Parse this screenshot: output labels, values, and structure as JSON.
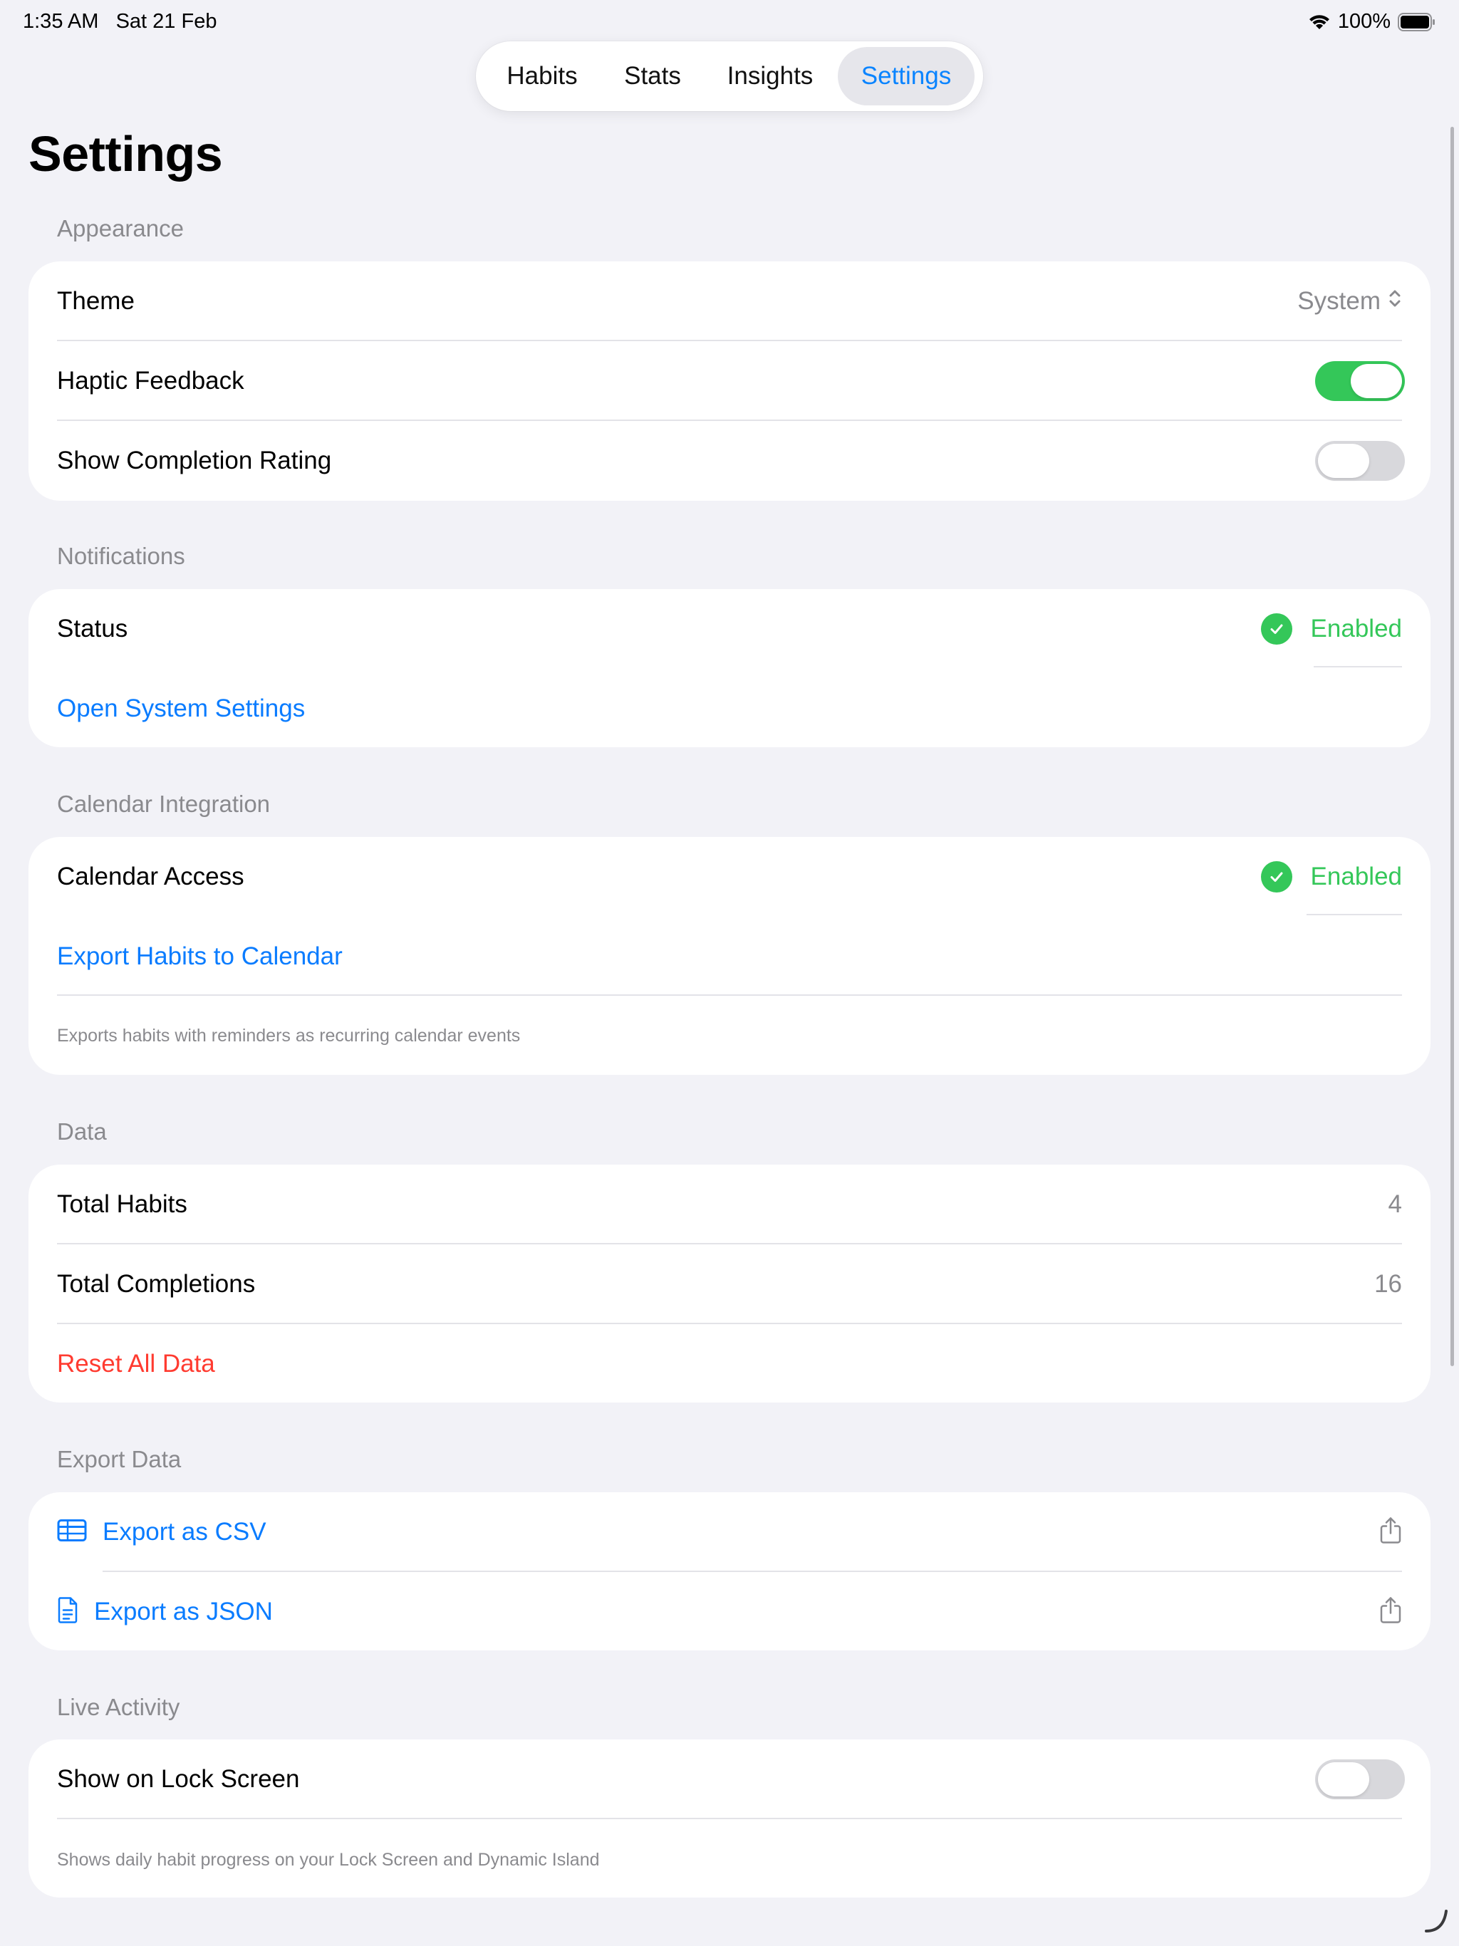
{
  "status_bar": {
    "time": "1:35 AM",
    "date": "Sat 21 Feb",
    "battery": "100%"
  },
  "tabs": [
    {
      "label": "Habits",
      "selected": false
    },
    {
      "label": "Stats",
      "selected": false
    },
    {
      "label": "Insights",
      "selected": false
    },
    {
      "label": "Settings",
      "selected": true
    }
  ],
  "page_title": "Settings",
  "appearance": {
    "header": "Appearance",
    "theme_label": "Theme",
    "theme_value": "System",
    "haptic_label": "Haptic Feedback",
    "haptic_on": true,
    "rating_label": "Show Completion Rating",
    "rating_on": false
  },
  "notifications": {
    "header": "Notifications",
    "status_label": "Status",
    "status_value": "Enabled",
    "open_settings": "Open System Settings"
  },
  "calendar": {
    "header": "Calendar Integration",
    "access_label": "Calendar Access",
    "access_value": "Enabled",
    "export_label": "Export Habits to Calendar",
    "footnote": "Exports habits with reminders as recurring calendar events"
  },
  "data": {
    "header": "Data",
    "total_habits_label": "Total Habits",
    "total_habits_value": "4",
    "total_completions_label": "Total Completions",
    "total_completions_value": "16",
    "reset_label": "Reset All Data"
  },
  "export": {
    "header": "Export Data",
    "csv_label": "Export as CSV",
    "json_label": "Export as JSON"
  },
  "live_activity": {
    "header": "Live Activity",
    "lock_screen_label": "Show on Lock Screen",
    "lock_screen_on": false,
    "footnote": "Shows daily habit progress on your Lock Screen and Dynamic Island"
  },
  "colors": {
    "accent": "#0a7cff",
    "success": "#34c759",
    "destructive": "#ff3b30",
    "background": "#f2f2f7"
  }
}
